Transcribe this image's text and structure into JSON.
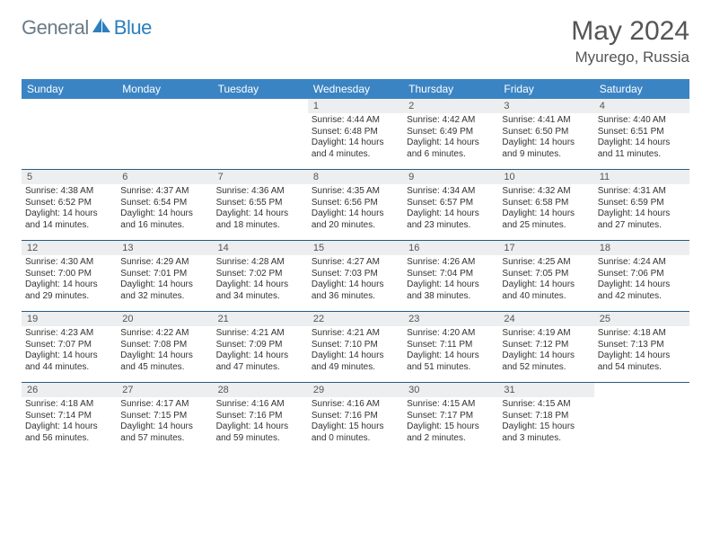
{
  "logo": {
    "part1": "General",
    "part2": "Blue"
  },
  "title": "May 2024",
  "location": "Myurego, Russia",
  "dayNames": [
    "Sunday",
    "Monday",
    "Tuesday",
    "Wednesday",
    "Thursday",
    "Friday",
    "Saturday"
  ],
  "weeks": [
    [
      null,
      null,
      null,
      {
        "n": "1",
        "sr": "Sunrise: 4:44 AM",
        "ss": "Sunset: 6:48 PM",
        "d1": "Daylight: 14 hours",
        "d2": "and 4 minutes."
      },
      {
        "n": "2",
        "sr": "Sunrise: 4:42 AM",
        "ss": "Sunset: 6:49 PM",
        "d1": "Daylight: 14 hours",
        "d2": "and 6 minutes."
      },
      {
        "n": "3",
        "sr": "Sunrise: 4:41 AM",
        "ss": "Sunset: 6:50 PM",
        "d1": "Daylight: 14 hours",
        "d2": "and 9 minutes."
      },
      {
        "n": "4",
        "sr": "Sunrise: 4:40 AM",
        "ss": "Sunset: 6:51 PM",
        "d1": "Daylight: 14 hours",
        "d2": "and 11 minutes."
      }
    ],
    [
      {
        "n": "5",
        "sr": "Sunrise: 4:38 AM",
        "ss": "Sunset: 6:52 PM",
        "d1": "Daylight: 14 hours",
        "d2": "and 14 minutes."
      },
      {
        "n": "6",
        "sr": "Sunrise: 4:37 AM",
        "ss": "Sunset: 6:54 PM",
        "d1": "Daylight: 14 hours",
        "d2": "and 16 minutes."
      },
      {
        "n": "7",
        "sr": "Sunrise: 4:36 AM",
        "ss": "Sunset: 6:55 PM",
        "d1": "Daylight: 14 hours",
        "d2": "and 18 minutes."
      },
      {
        "n": "8",
        "sr": "Sunrise: 4:35 AM",
        "ss": "Sunset: 6:56 PM",
        "d1": "Daylight: 14 hours",
        "d2": "and 20 minutes."
      },
      {
        "n": "9",
        "sr": "Sunrise: 4:34 AM",
        "ss": "Sunset: 6:57 PM",
        "d1": "Daylight: 14 hours",
        "d2": "and 23 minutes."
      },
      {
        "n": "10",
        "sr": "Sunrise: 4:32 AM",
        "ss": "Sunset: 6:58 PM",
        "d1": "Daylight: 14 hours",
        "d2": "and 25 minutes."
      },
      {
        "n": "11",
        "sr": "Sunrise: 4:31 AM",
        "ss": "Sunset: 6:59 PM",
        "d1": "Daylight: 14 hours",
        "d2": "and 27 minutes."
      }
    ],
    [
      {
        "n": "12",
        "sr": "Sunrise: 4:30 AM",
        "ss": "Sunset: 7:00 PM",
        "d1": "Daylight: 14 hours",
        "d2": "and 29 minutes."
      },
      {
        "n": "13",
        "sr": "Sunrise: 4:29 AM",
        "ss": "Sunset: 7:01 PM",
        "d1": "Daylight: 14 hours",
        "d2": "and 32 minutes."
      },
      {
        "n": "14",
        "sr": "Sunrise: 4:28 AM",
        "ss": "Sunset: 7:02 PM",
        "d1": "Daylight: 14 hours",
        "d2": "and 34 minutes."
      },
      {
        "n": "15",
        "sr": "Sunrise: 4:27 AM",
        "ss": "Sunset: 7:03 PM",
        "d1": "Daylight: 14 hours",
        "d2": "and 36 minutes."
      },
      {
        "n": "16",
        "sr": "Sunrise: 4:26 AM",
        "ss": "Sunset: 7:04 PM",
        "d1": "Daylight: 14 hours",
        "d2": "and 38 minutes."
      },
      {
        "n": "17",
        "sr": "Sunrise: 4:25 AM",
        "ss": "Sunset: 7:05 PM",
        "d1": "Daylight: 14 hours",
        "d2": "and 40 minutes."
      },
      {
        "n": "18",
        "sr": "Sunrise: 4:24 AM",
        "ss": "Sunset: 7:06 PM",
        "d1": "Daylight: 14 hours",
        "d2": "and 42 minutes."
      }
    ],
    [
      {
        "n": "19",
        "sr": "Sunrise: 4:23 AM",
        "ss": "Sunset: 7:07 PM",
        "d1": "Daylight: 14 hours",
        "d2": "and 44 minutes."
      },
      {
        "n": "20",
        "sr": "Sunrise: 4:22 AM",
        "ss": "Sunset: 7:08 PM",
        "d1": "Daylight: 14 hours",
        "d2": "and 45 minutes."
      },
      {
        "n": "21",
        "sr": "Sunrise: 4:21 AM",
        "ss": "Sunset: 7:09 PM",
        "d1": "Daylight: 14 hours",
        "d2": "and 47 minutes."
      },
      {
        "n": "22",
        "sr": "Sunrise: 4:21 AM",
        "ss": "Sunset: 7:10 PM",
        "d1": "Daylight: 14 hours",
        "d2": "and 49 minutes."
      },
      {
        "n": "23",
        "sr": "Sunrise: 4:20 AM",
        "ss": "Sunset: 7:11 PM",
        "d1": "Daylight: 14 hours",
        "d2": "and 51 minutes."
      },
      {
        "n": "24",
        "sr": "Sunrise: 4:19 AM",
        "ss": "Sunset: 7:12 PM",
        "d1": "Daylight: 14 hours",
        "d2": "and 52 minutes."
      },
      {
        "n": "25",
        "sr": "Sunrise: 4:18 AM",
        "ss": "Sunset: 7:13 PM",
        "d1": "Daylight: 14 hours",
        "d2": "and 54 minutes."
      }
    ],
    [
      {
        "n": "26",
        "sr": "Sunrise: 4:18 AM",
        "ss": "Sunset: 7:14 PM",
        "d1": "Daylight: 14 hours",
        "d2": "and 56 minutes."
      },
      {
        "n": "27",
        "sr": "Sunrise: 4:17 AM",
        "ss": "Sunset: 7:15 PM",
        "d1": "Daylight: 14 hours",
        "d2": "and 57 minutes."
      },
      {
        "n": "28",
        "sr": "Sunrise: 4:16 AM",
        "ss": "Sunset: 7:16 PM",
        "d1": "Daylight: 14 hours",
        "d2": "and 59 minutes."
      },
      {
        "n": "29",
        "sr": "Sunrise: 4:16 AM",
        "ss": "Sunset: 7:16 PM",
        "d1": "Daylight: 15 hours",
        "d2": "and 0 minutes."
      },
      {
        "n": "30",
        "sr": "Sunrise: 4:15 AM",
        "ss": "Sunset: 7:17 PM",
        "d1": "Daylight: 15 hours",
        "d2": "and 2 minutes."
      },
      {
        "n": "31",
        "sr": "Sunrise: 4:15 AM",
        "ss": "Sunset: 7:18 PM",
        "d1": "Daylight: 15 hours",
        "d2": "and 3 minutes."
      },
      null
    ]
  ]
}
